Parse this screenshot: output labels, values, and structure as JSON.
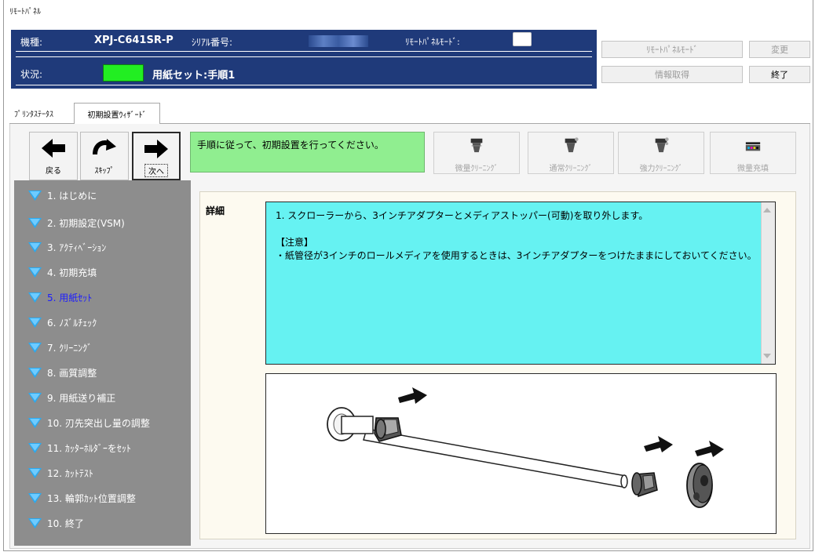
{
  "window": {
    "title": "ﾘﾓｰﾄﾊﾟﾈﾙ"
  },
  "header": {
    "model_label": "機種:",
    "model_value": "XPJ-C641SR-P",
    "serial_label": "ｼﾘｱﾙ番号:",
    "remote_mode_label": "ﾘﾓｰﾄﾊﾟﾈﾙﾓｰﾄﾞ:",
    "status_label": "状況:",
    "status_color": "#22ee22",
    "status_text": "用紙セット:手順1"
  },
  "top_buttons": {
    "remote_mode": "ﾘﾓｰﾄﾊﾟﾈﾙﾓｰﾄﾞ",
    "change": "変更",
    "get_info": "情報取得",
    "exit": "終了"
  },
  "tabs": [
    {
      "label": "ﾌﾟﾘﾝﾀｽﾃｰﾀｽ",
      "active": false
    },
    {
      "label": "初期設置ｳｨｻﾞｰﾄﾞ",
      "active": true
    }
  ],
  "nav": {
    "back": "戻る",
    "skip": "ｽｷｯﾌﾟ",
    "next": "次へ"
  },
  "instruction": "手順に従って、初期設置を行ってください。",
  "tools": [
    {
      "label": "微量ｸﾘｰﾆﾝｸﾞ",
      "icon": "micro-cleaning-icon"
    },
    {
      "label": "通常ｸﾘｰﾆﾝｸﾞ",
      "icon": "normal-cleaning-icon"
    },
    {
      "label": "強力ｸﾘｰﾆﾝｸﾞ",
      "icon": "strong-cleaning-icon"
    },
    {
      "label": "微量充填",
      "icon": "micro-fill-icon"
    }
  ],
  "steps": [
    {
      "label": "1. はじめに",
      "current": false
    },
    {
      "label": "2. 初期設定(VSM)",
      "current": false
    },
    {
      "label": "3. ｱｸﾃｨﾍﾞｰｼｮﾝ",
      "current": false
    },
    {
      "label": "4. 初期充填",
      "current": false
    },
    {
      "label": "5. 用紙ｾｯﾄ",
      "current": true
    },
    {
      "label": "6. ﾉｽﾞﾙﾁｪｯｸ",
      "current": false
    },
    {
      "label": "7. ｸﾘｰﾆﾝｸﾞ",
      "current": false
    },
    {
      "label": "8. 画質調整",
      "current": false
    },
    {
      "label": "9. 用紙送り補正",
      "current": false
    },
    {
      "label": "10. 刃先突出し量の調整",
      "current": false
    },
    {
      "label": "11. ｶｯﾀｰﾎﾙﾀﾞｰをｾｯﾄ",
      "current": false
    },
    {
      "label": "12. ｶｯﾄﾃｽﾄ",
      "current": false
    },
    {
      "label": "13. 輪郭ｶｯﾄ位置調整",
      "current": false
    },
    {
      "label": "10. 終了",
      "current": false
    }
  ],
  "detail": {
    "label": "詳細",
    "line1": "1. スクローラーから、3インチアダプターとメディアストッパー(可動)を取り外します。",
    "note_title": "【注意】",
    "note_body": "・紙管径が3インチのロールメディアを使用するときは、3インチアダプターをつけたままにしておいてください。"
  },
  "illustration": {
    "icon": "scroller-adapter-removal-illustration"
  }
}
